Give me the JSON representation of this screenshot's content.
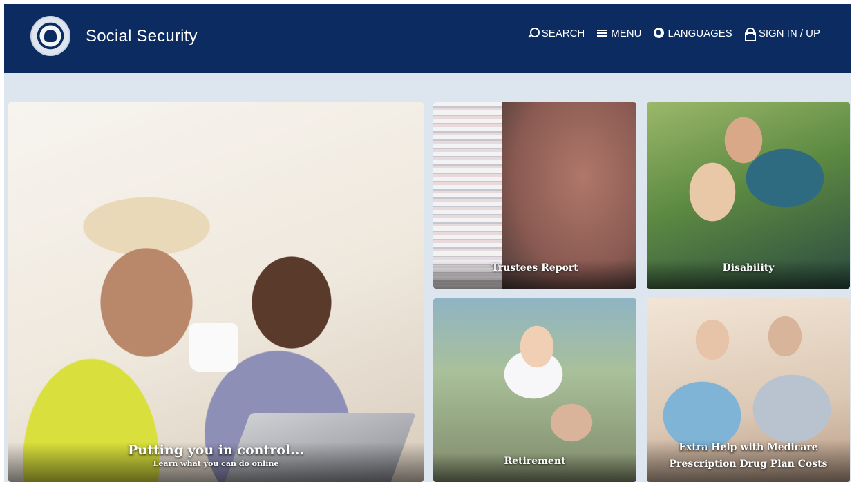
{
  "header": {
    "site_title": "Social Security",
    "logo_icon": "ssa-seal-icon",
    "nav": {
      "search": "SEARCH",
      "menu": "MENU",
      "languages": "LANGUAGES",
      "signin": "SIGN IN / UP"
    },
    "nav_icons": [
      "search-icon",
      "menu-icon",
      "globe-icon",
      "lock-icon"
    ]
  },
  "hero": {
    "title": "Putting you in control...",
    "subtitle": "Learn what you can do online"
  },
  "tiles": [
    {
      "label": "Trustees Report"
    },
    {
      "label": "Disability"
    },
    {
      "label": "Retirement"
    },
    {
      "label": "Extra Help with Medicare Prescription Drug Plan Costs"
    }
  ],
  "colors": {
    "header_bg": "#0b2b61",
    "band_bg": "#dde6ee",
    "text_light": "#ffffff"
  }
}
